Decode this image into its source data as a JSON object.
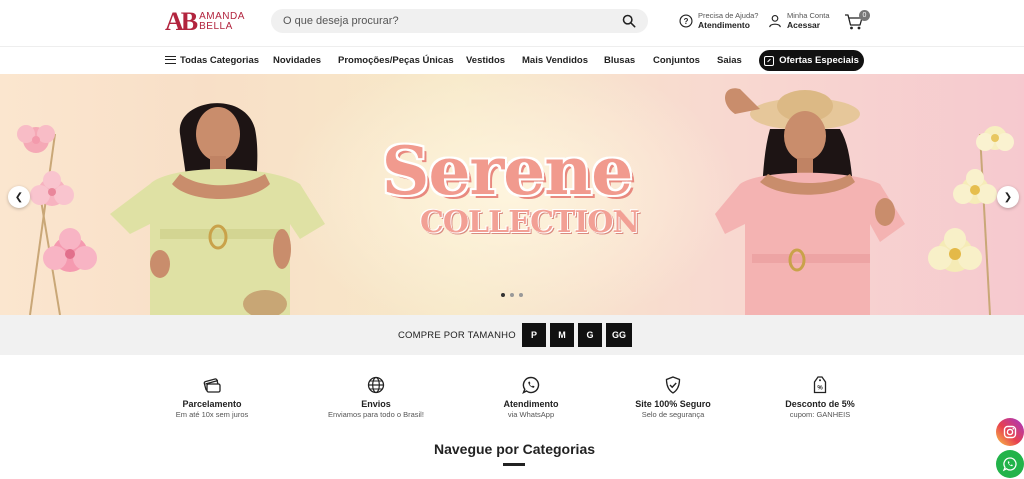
{
  "brand": {
    "logo_mark": "AB",
    "logo_line1": "AMANDA",
    "logo_line2": "BELLA"
  },
  "search": {
    "placeholder": "O que deseja procurar?"
  },
  "help": {
    "small": "Precisa de Ajuda?",
    "strong": "Atendimento"
  },
  "account": {
    "small": "Minha Conta",
    "strong": "Acessar"
  },
  "cart": {
    "count": "0"
  },
  "nav": {
    "all_categories": "Todas Categorias",
    "items": [
      "Novidades",
      "Promoções/Peças Únicas",
      "Vestidos",
      "Mais Vendidos",
      "Blusas",
      "Conjuntos",
      "Saias"
    ],
    "offers": "Ofertas Especiais"
  },
  "hero": {
    "title": "Serene",
    "subtitle": "COLLECTION",
    "slide_count": 3,
    "active_slide": 1
  },
  "sizes": {
    "label": "COMPRE POR TAMANHO",
    "options": [
      "P",
      "M",
      "G",
      "GG"
    ]
  },
  "benefits": [
    {
      "icon": "card-icon",
      "title": "Parcelamento",
      "subtitle": "Em até 10x sem juros"
    },
    {
      "icon": "globe-icon",
      "title": "Envios",
      "subtitle": "Enviamos para todo o Brasil!"
    },
    {
      "icon": "whatsapp-icon",
      "title": "Atendimento",
      "subtitle": "via WhatsApp"
    },
    {
      "icon": "shield-icon",
      "title": "Site 100% Seguro",
      "subtitle": "Selo de segurança"
    },
    {
      "icon": "discount-tag-icon",
      "title": "Desconto de 5%",
      "subtitle": "cupom: GANHEIS"
    }
  ],
  "categories": {
    "heading": "Navegue por Categorias"
  },
  "colors": {
    "brand": "#b2243e",
    "title_pink": "#f19a8e",
    "dark": "#111111",
    "whatsapp": "#22b34a"
  }
}
